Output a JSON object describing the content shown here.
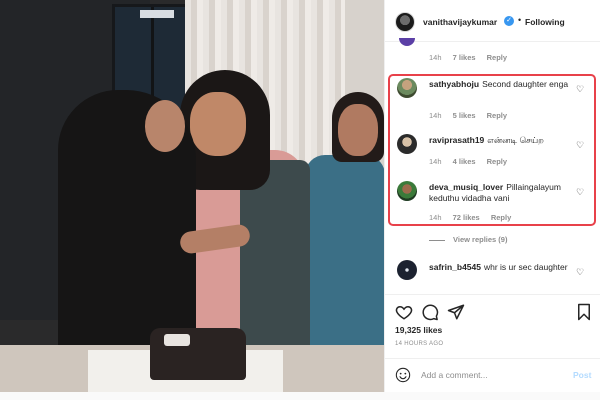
{
  "post": {
    "username": "vanithavijaykumar",
    "follow_state": "Following",
    "likes_count": "19,325 likes",
    "time_ago": "14 HOURS AGO"
  },
  "top_comment_meta": {
    "time": "14h",
    "likes": "7 likes",
    "reply": "Reply"
  },
  "comments": [
    {
      "user": "sathyabhoju",
      "text": "Second daughter enga",
      "time": "14h",
      "likes": "5 likes",
      "reply": "Reply"
    },
    {
      "user": "raviprasath19",
      "text": "என்னடி செய்ற",
      "time": "14h",
      "likes": "4 likes",
      "reply": "Reply"
    },
    {
      "user": "deva_musiq_lover",
      "text": "Pillaingalayum keduthu vidadha vani",
      "time": "14h",
      "likes": "72 likes",
      "reply": "Reply"
    },
    {
      "user": "safrin_b4545",
      "text": "whr is ur sec daughter"
    }
  ],
  "view_replies": "View replies (9)",
  "add_comment": {
    "placeholder": "Add a comment...",
    "post_label": "Post"
  },
  "icons": {
    "verified": "verified-badge-icon",
    "heart": "heart-icon",
    "comment": "comment-icon",
    "share": "share-icon",
    "save": "bookmark-icon",
    "emoji": "emoji-icon"
  },
  "colors": {
    "highlight_border": "#e8414a",
    "verified_blue": "#3897f0",
    "post_button_disabled": "#b3dbff",
    "meta_gray": "#8e8e8e"
  }
}
